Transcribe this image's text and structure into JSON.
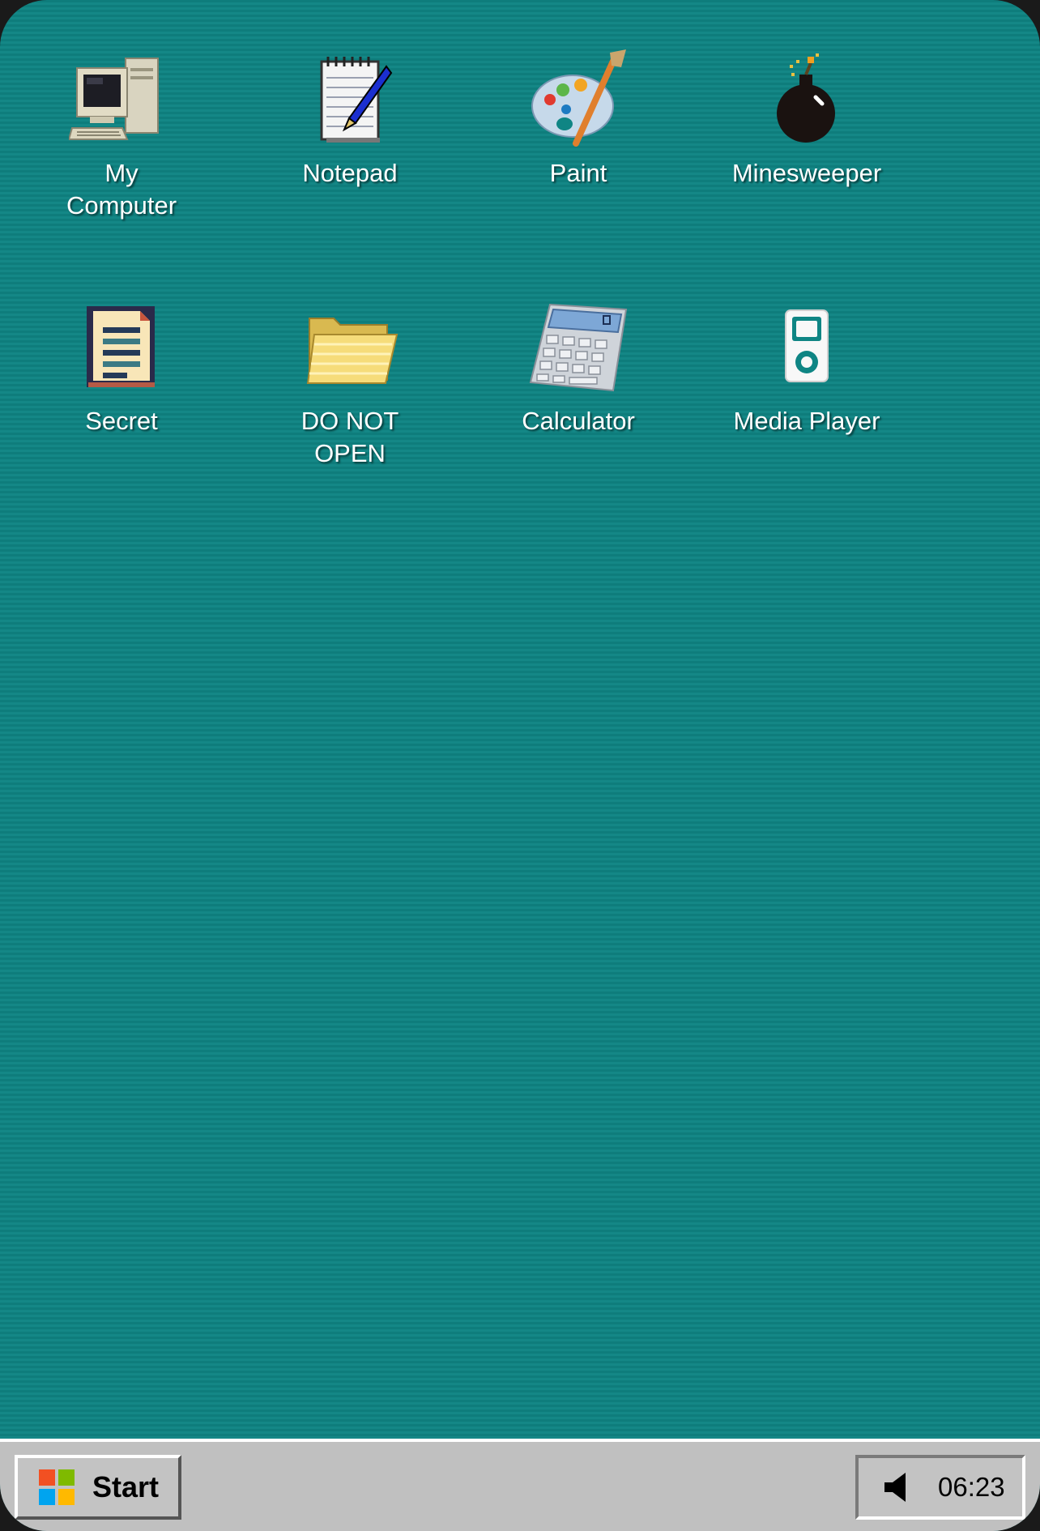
{
  "desktop": {
    "background_color": "#0f8584",
    "icons": [
      {
        "label": "My\nComputer",
        "icon": "computer-icon"
      },
      {
        "label": "Notepad",
        "icon": "notepad-icon"
      },
      {
        "label": "Paint",
        "icon": "paint-palette-icon"
      },
      {
        "label": "Minesweeper",
        "icon": "bomb-icon"
      },
      {
        "label": "Secret",
        "icon": "document-icon"
      },
      {
        "label": "DO NOT\nOPEN",
        "icon": "folder-icon"
      },
      {
        "label": "Calculator",
        "icon": "calculator-icon"
      },
      {
        "label": "Media Player",
        "icon": "music-player-icon"
      }
    ]
  },
  "taskbar": {
    "start_label": "Start",
    "clock": "06:23",
    "tray_icon": "speaker-icon"
  }
}
